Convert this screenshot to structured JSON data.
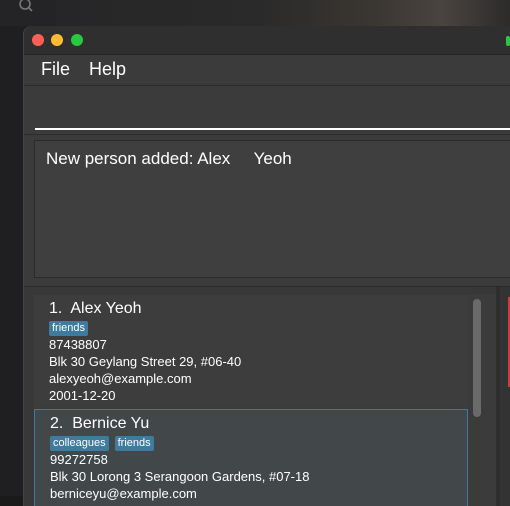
{
  "window": {
    "controls": [
      "close",
      "minimize",
      "maximize"
    ]
  },
  "menu": {
    "file": "File",
    "help": "Help"
  },
  "command_box": {
    "value": "",
    "placeholder": ""
  },
  "result_display": {
    "text": "New person added: Alex     Yeoh"
  },
  "person_list": {
    "persons": [
      {
        "name": "1.  Alex Yeoh",
        "tags": [
          "friends"
        ],
        "phone": "87438807",
        "address": "Blk 30 Geylang Street 29, #06-40",
        "email": "alexyeoh@example.com",
        "date": "2001-12-20"
      },
      {
        "name": "2.  Bernice Yu",
        "tags": [
          "colleagues",
          "friends"
        ],
        "phone": "99272758",
        "address": "Blk 30 Lorong 3 Serangoon Gardens, #07-18",
        "email": "berniceyu@example.com"
      }
    ]
  },
  "colors": {
    "tag": "#3e7b9f",
    "selected_border": "#3f7a9c",
    "background": "#3b3b3c"
  }
}
